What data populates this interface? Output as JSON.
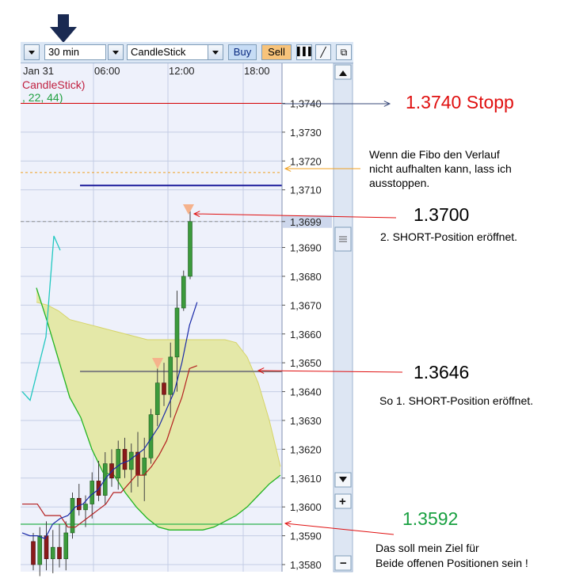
{
  "toolbar": {
    "timeframe": "30 min",
    "chart_type": "CandleStick",
    "buy_label": "Buy",
    "sell_label": "Sell"
  },
  "chart_header": {
    "indicator_name": "CandleStick)",
    "indicator_params": ", 22, 44)"
  },
  "colors": {
    "cloud_fill": "#e4e8a8",
    "cloud_edge_top": "#d6d468",
    "cloud_edge_bottom": "#22b422",
    "tenkan": "#1a2aa8",
    "kijun": "#b42020",
    "chikou": "#22c8c0",
    "stop_line": "#d40000",
    "fibo_line": "#f0a020",
    "resistance_line": "#1c1c9c",
    "entry_line": "#808080",
    "target_line": "#2cb44c",
    "annotation_red": "#e01010",
    "annotation_green": "#18a040",
    "arrow_blue": "#3a4a7a"
  },
  "annotations": {
    "stop_label": "1.3740 Stopp",
    "fibo_note_line1": "Wenn die Fibo den Verlauf",
    "fibo_note_line2": "nicht aufhalten kann, lass ich",
    "fibo_note_line3": "ausstoppen.",
    "second_entry_value": "1.3700",
    "second_entry_note": "2. SHORT-Position eröffnet.",
    "first_entry_value": "1.3646",
    "first_entry_note": "So 1. SHORT-Position eröffnet.",
    "target_value": "1.3592",
    "target_note_line1": "Das soll mein  Ziel für",
    "target_note_line2": "Beide offenen Positionen sein !"
  },
  "chart_data": {
    "type": "candlestick",
    "x_ticks": [
      "Jan 31",
      "06:00",
      "12:00",
      "18:00"
    ],
    "y_ticks": [
      "1,3580",
      "1,3590",
      "1,3600",
      "1,3610",
      "1,3620",
      "1,3630",
      "1,3640",
      "1,3650",
      "1,3660",
      "1,3670",
      "1,3680",
      "1,3690",
      "1,3699",
      "1,3710",
      "1,3720",
      "1,3730",
      "1,3740"
    ],
    "ylim": [
      1.3576,
      1.3752
    ],
    "current_price_label": "1,3699",
    "horizontal_levels": {
      "stop": 1.374,
      "fibo": 1.3716,
      "resistance": 1.37115,
      "entry_2": 1.3699,
      "entry_1": 1.3647,
      "target": 1.3594
    },
    "candles": [
      {
        "o": 1.3588,
        "h": 1.3591,
        "l": 1.3578,
        "c": 1.358
      },
      {
        "o": 1.358,
        "h": 1.3593,
        "l": 1.3576,
        "c": 1.359
      },
      {
        "o": 1.359,
        "h": 1.3595,
        "l": 1.3578,
        "c": 1.3582
      },
      {
        "o": 1.3582,
        "h": 1.3592,
        "l": 1.3577,
        "c": 1.3586
      },
      {
        "o": 1.3586,
        "h": 1.3594,
        "l": 1.3579,
        "c": 1.3582
      },
      {
        "o": 1.3582,
        "h": 1.3595,
        "l": 1.3578,
        "c": 1.3591
      },
      {
        "o": 1.3591,
        "h": 1.3605,
        "l": 1.3589,
        "c": 1.3603
      },
      {
        "o": 1.3603,
        "h": 1.3608,
        "l": 1.3597,
        "c": 1.3599
      },
      {
        "o": 1.3599,
        "h": 1.3604,
        "l": 1.3593,
        "c": 1.3601
      },
      {
        "o": 1.3601,
        "h": 1.3612,
        "l": 1.3596,
        "c": 1.3609
      },
      {
        "o": 1.3609,
        "h": 1.3616,
        "l": 1.3602,
        "c": 1.3604
      },
      {
        "o": 1.3604,
        "h": 1.3619,
        "l": 1.3601,
        "c": 1.3615
      },
      {
        "o": 1.3615,
        "h": 1.362,
        "l": 1.3607,
        "c": 1.361
      },
      {
        "o": 1.361,
        "h": 1.3623,
        "l": 1.3606,
        "c": 1.362
      },
      {
        "o": 1.362,
        "h": 1.3624,
        "l": 1.361,
        "c": 1.3613
      },
      {
        "o": 1.3613,
        "h": 1.3622,
        "l": 1.3605,
        "c": 1.3619
      },
      {
        "o": 1.3619,
        "h": 1.3626,
        "l": 1.3607,
        "c": 1.3611
      },
      {
        "o": 1.3611,
        "h": 1.3624,
        "l": 1.3602,
        "c": 1.3617
      },
      {
        "o": 1.3617,
        "h": 1.3634,
        "l": 1.3615,
        "c": 1.3632
      },
      {
        "o": 1.3632,
        "h": 1.3648,
        "l": 1.3628,
        "c": 1.3643
      },
      {
        "o": 1.3643,
        "h": 1.365,
        "l": 1.3635,
        "c": 1.3639
      },
      {
        "o": 1.3639,
        "h": 1.3657,
        "l": 1.3631,
        "c": 1.3652
      },
      {
        "o": 1.3652,
        "h": 1.3675,
        "l": 1.364,
        "c": 1.3669
      },
      {
        "o": 1.3669,
        "h": 1.3682,
        "l": 1.3668,
        "c": 1.368
      },
      {
        "o": 1.368,
        "h": 1.3704,
        "l": 1.3679,
        "c": 1.3699
      }
    ],
    "cloud_upper": [
      1.3671,
      1.367,
      1.3668,
      1.3665,
      1.3664,
      1.3663,
      1.3662,
      1.3661,
      1.366,
      1.3659,
      1.3658,
      1.3658,
      1.3658,
      1.3658,
      1.3658,
      1.3658,
      1.3658,
      1.3658,
      1.3657,
      1.3652,
      1.3643,
      1.363,
      1.3614
    ],
    "cloud_lower": [
      1.3676,
      1.3664,
      1.3651,
      1.3638,
      1.3631,
      1.362,
      1.3612,
      1.3611,
      1.3605,
      1.36,
      1.3596,
      1.3593,
      1.3592,
      1.3592,
      1.3592,
      1.3592,
      1.3593,
      1.3595,
      1.3597,
      1.36,
      1.3604,
      1.3608,
      1.3611
    ],
    "tenkan_sen": [
      1.3591,
      1.359,
      1.359,
      1.3589,
      1.3594,
      1.3596,
      1.3597,
      1.36,
      1.3601,
      1.3604,
      1.3606,
      1.361,
      1.3613,
      1.3615,
      1.3616,
      1.3618,
      1.362,
      1.3624,
      1.3628,
      1.3634,
      1.364,
      1.365,
      1.3663,
      1.3671
    ],
    "kijun_sen": [
      1.3601,
      1.3601,
      1.3601,
      1.3597,
      1.3597,
      1.3597,
      1.3593,
      1.3593,
      1.3595,
      1.3597,
      1.3599,
      1.3601,
      1.3605,
      1.3605,
      1.3608,
      1.3611,
      1.3611,
      1.3614,
      1.3618,
      1.3623,
      1.3631,
      1.3638,
      1.3648,
      1.3649
    ],
    "chikou_span": [
      1.364,
      1.3637,
      1.3659,
      1.3694,
      1.3689
    ]
  }
}
